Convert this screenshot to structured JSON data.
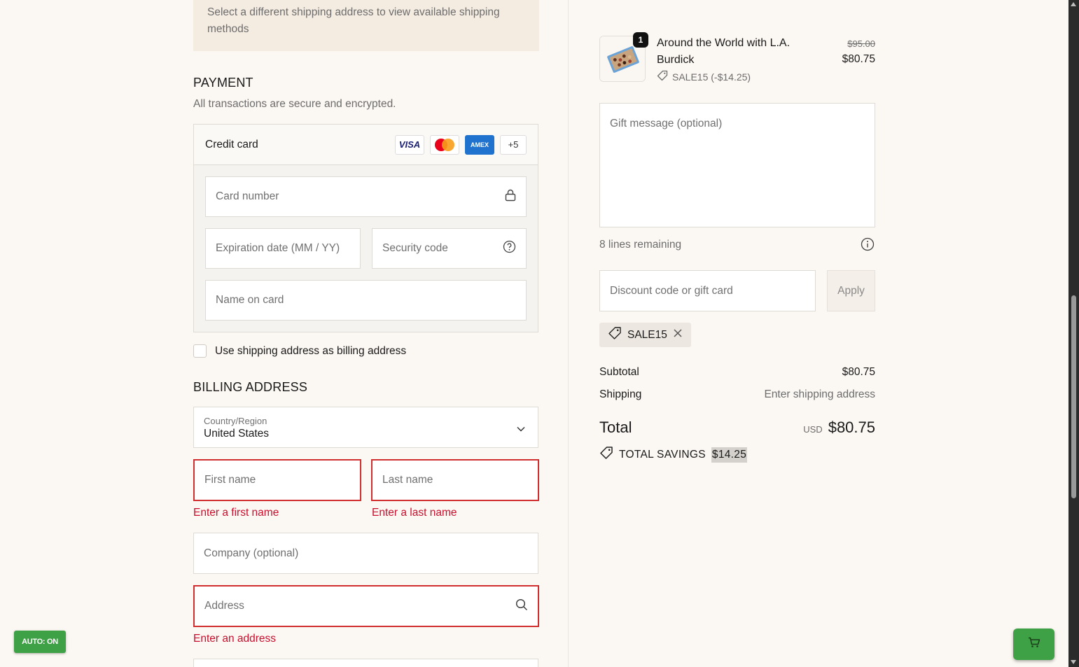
{
  "shipping_notice": "Select a different shipping address to view available shipping methods",
  "payment": {
    "title": "PAYMENT",
    "subtitle": "All transactions are secure and encrypted.",
    "method_label": "Credit card",
    "card_logos": [
      "VISA",
      "Mastercard",
      "AMEX",
      "+5"
    ],
    "fields": {
      "card_number": "Card number",
      "expiration": "Expiration date (MM / YY)",
      "security_code": "Security code",
      "name_on_card": "Name on card"
    }
  },
  "billing_checkbox_label": "Use shipping address as billing address",
  "billing": {
    "title": "BILLING ADDRESS",
    "country_label": "Country/Region",
    "country_value": "United States",
    "first_name": "First name",
    "first_name_error": "Enter a first name",
    "last_name": "Last name",
    "last_name_error": "Enter a last name",
    "company": "Company (optional)",
    "address": "Address",
    "address_error": "Enter an address"
  },
  "order": {
    "quantity": "1",
    "product_name": "Around the World with L.A. Burdick",
    "discount_tag": "SALE15 (-$14.25)",
    "price_original": "$95.00",
    "price_final": "$80.75",
    "gift_message_placeholder": "Gift message (optional)",
    "lines_remaining": "8 lines remaining",
    "discount_placeholder": "Discount code or gift card",
    "apply_label": "Apply",
    "applied_code": "SALE15",
    "subtotal_label": "Subtotal",
    "subtotal_value": "$80.75",
    "shipping_label": "Shipping",
    "shipping_value": "Enter shipping address",
    "total_label": "Total",
    "currency": "USD",
    "total_value": "$80.75",
    "savings_label": "TOTAL SAVINGS",
    "savings_value": "$14.25"
  },
  "auto_badge": "AUTO: ON",
  "icons": {
    "lock": "lock-icon",
    "help": "question-circle-icon",
    "chevron": "chevron-down-icon",
    "tag": "tag-icon",
    "info": "info-icon",
    "close": "close-icon",
    "search": "search-icon",
    "cart": "cart-icon"
  },
  "colors": {
    "background": "#fbf7f2",
    "error": "#d12f2f",
    "badge_green": "#3fa146"
  }
}
